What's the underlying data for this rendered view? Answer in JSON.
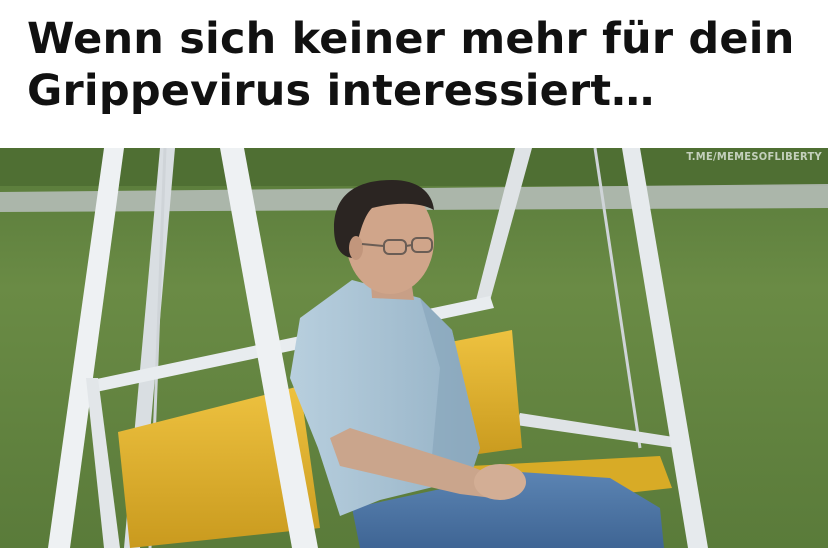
{
  "caption": {
    "line1": "Wenn sich keiner mehr für dein",
    "line2": "Grippevirus interessiert…"
  },
  "watermark": "T.ME/MEMESOFLIBERTY",
  "colors": {
    "background": "#ffffff",
    "caption_text": "#111111",
    "grass": "#5f7f3f",
    "swing_frame": "#e8ecef",
    "cushion": "#e0b52a",
    "shirt": "#a9c4d6",
    "jeans": "#4f78a8"
  }
}
